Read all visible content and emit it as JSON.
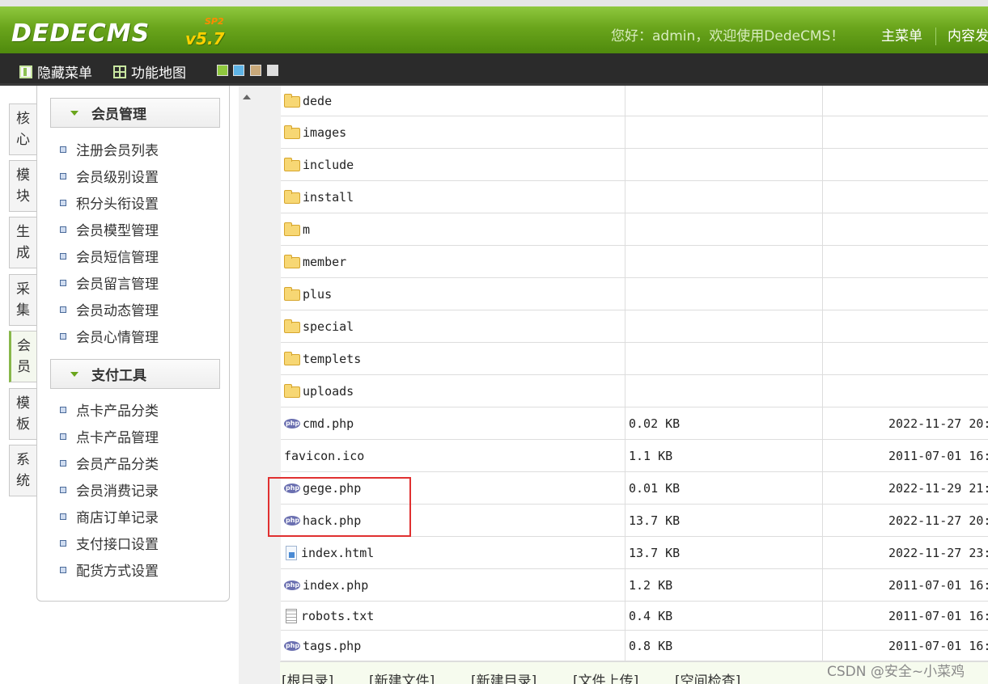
{
  "header": {
    "logo": "DEDECMS",
    "version": "v5.7",
    "version_tag": "SP2",
    "welcome": "您好：admin，欢迎使用DedeCMS！",
    "nav": [
      "主菜单",
      "内容发"
    ]
  },
  "toolbar": {
    "hide_menu": "隐藏菜单",
    "function_map": "功能地图",
    "skins": [
      "#8fc83e",
      "#5fb4e6",
      "#c9a97a",
      "#dddddd"
    ]
  },
  "left_tabs": [
    {
      "l1": "核",
      "l2": "心"
    },
    {
      "l1": "模",
      "l2": "块"
    },
    {
      "l1": "生",
      "l2": "成"
    },
    {
      "l1": "采",
      "l2": "集"
    },
    {
      "l1": "会",
      "l2": "员"
    },
    {
      "l1": "模",
      "l2": "板"
    },
    {
      "l1": "系",
      "l2": "统"
    }
  ],
  "menu": {
    "groups": [
      {
        "title": "会员管理",
        "items": [
          "注册会员列表",
          "会员级别设置",
          "积分头衔设置",
          "会员模型管理",
          "会员短信管理",
          "会员留言管理",
          "会员动态管理",
          "会员心情管理"
        ]
      },
      {
        "title": "支付工具",
        "items": [
          "点卡产品分类",
          "点卡产品管理",
          "会员产品分类",
          "会员消费记录",
          "商店订单记录",
          "支付接口设置",
          "配货方式设置"
        ]
      }
    ]
  },
  "files": [
    {
      "name": "dede",
      "type": "folder",
      "size": "",
      "date": ""
    },
    {
      "name": "images",
      "type": "folder",
      "size": "",
      "date": ""
    },
    {
      "name": "include",
      "type": "folder",
      "size": "",
      "date": ""
    },
    {
      "name": "install",
      "type": "folder",
      "size": "",
      "date": ""
    },
    {
      "name": "m",
      "type": "folder",
      "size": "",
      "date": ""
    },
    {
      "name": "member",
      "type": "folder",
      "size": "",
      "date": ""
    },
    {
      "name": "plus",
      "type": "folder",
      "size": "",
      "date": ""
    },
    {
      "name": "special",
      "type": "folder",
      "size": "",
      "date": ""
    },
    {
      "name": "templets",
      "type": "folder",
      "size": "",
      "date": ""
    },
    {
      "name": "uploads",
      "type": "folder",
      "size": "",
      "date": ""
    },
    {
      "name": "cmd.php",
      "type": "php",
      "size": "0.02 KB",
      "date": "2022-11-27 20:"
    },
    {
      "name": "favicon.ico",
      "type": "none",
      "size": "1.1 KB",
      "date": "2011-07-01 16:"
    },
    {
      "name": "gege.php",
      "type": "php",
      "size": "0.01 KB",
      "date": "2022-11-29 21:"
    },
    {
      "name": "hack.php",
      "type": "php",
      "size": "13.7 KB",
      "date": "2022-11-27 20:"
    },
    {
      "name": "index.html",
      "type": "html",
      "size": "13.7 KB",
      "date": "2022-11-27 23:"
    },
    {
      "name": "index.php",
      "type": "php",
      "size": "1.2 KB",
      "date": "2011-07-01 16:"
    },
    {
      "name": "robots.txt",
      "type": "txt",
      "size": "0.4 KB",
      "date": "2011-07-01 16:"
    },
    {
      "name": "tags.php",
      "type": "php",
      "size": "0.8 KB",
      "date": "2011-07-01 16:"
    }
  ],
  "actions": [
    "[根目录]",
    "[新建文件]",
    "[新建目录]",
    "[文件上传]",
    "[空间检查]"
  ],
  "watermark": "CSDN @安全~小菜鸡",
  "colors": {
    "header_green": "#6aa51c",
    "toolbar_dark": "#2b2b2b",
    "highlight_red": "#e03030"
  }
}
